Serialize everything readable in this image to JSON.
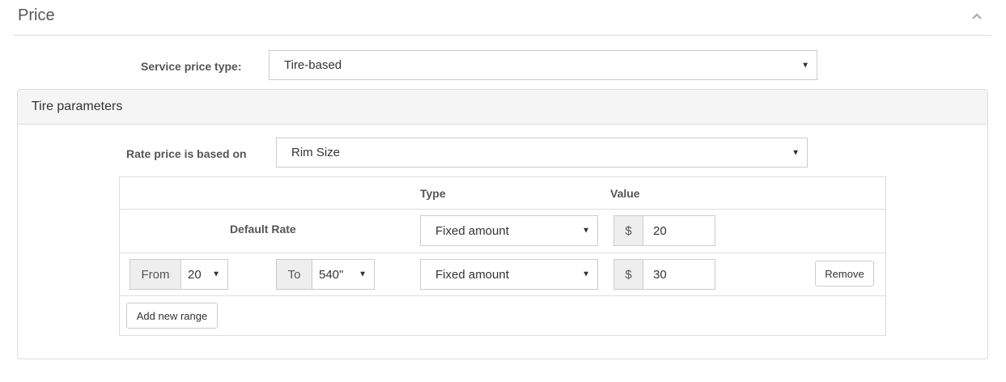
{
  "section": {
    "title": "Price"
  },
  "service_price_type": {
    "label": "Service price type:",
    "value": "Tire-based"
  },
  "panel": {
    "title": "Tire parameters"
  },
  "rate_basis": {
    "label": "Rate price is based on",
    "value": "Rim Size"
  },
  "table": {
    "headers": {
      "type": "Type",
      "value": "Value"
    },
    "default_rate": {
      "label": "Default Rate",
      "type": "Fixed amount",
      "currency": "$",
      "value": "20"
    },
    "ranges": [
      {
        "from_label": "From",
        "from_value": "20",
        "to_label": "To",
        "to_value": "540\"",
        "type": "Fixed amount",
        "currency": "$",
        "value": "30",
        "remove_label": "Remove"
      }
    ],
    "add_range_label": "Add new range"
  },
  "icons": {
    "collapse": "chevron-up-icon",
    "dropdown": "caret-down-icon"
  }
}
